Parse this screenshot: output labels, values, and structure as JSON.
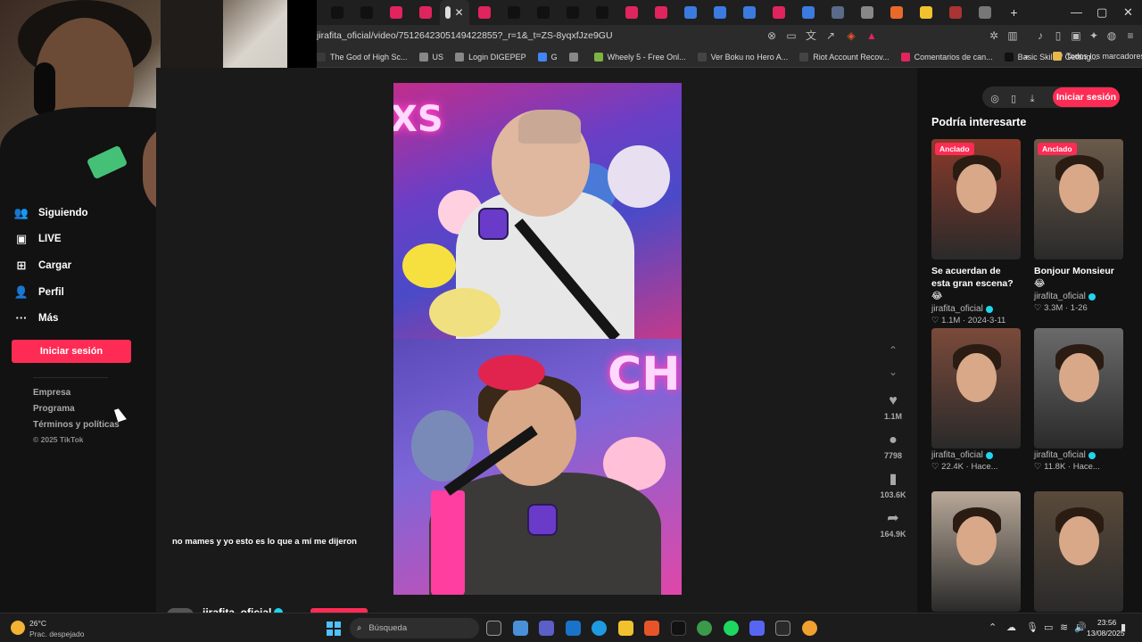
{
  "browser": {
    "url": "jirafita_oficial/video/7512642305149422855?_r=1&_t=ZS-8yqxfJze9GU",
    "tab_favicon_colors": [
      "#111",
      "#111",
      "#e0245e",
      "#e0245e",
      "#ddd",
      "#e0245e",
      "#111",
      "#111",
      "#111",
      "#111",
      "#e0245e",
      "#e0245e",
      "#3b7be0",
      "#3b7be0",
      "#3b7be0",
      "#e0245e",
      "#3b7be0",
      "#5a6a8a",
      "#888",
      "#e86a2a",
      "#f2c12e",
      "#a33",
      "#777"
    ],
    "bookmarks": [
      {
        "label": "The God of High Sc...",
        "color": "#3a3a3a"
      },
      {
        "label": "US",
        "color": "#888"
      },
      {
        "label": "Login DIGEPEP",
        "color": "#888"
      },
      {
        "label": "G",
        "color": "#4285f4"
      },
      {
        "label": "",
        "color": "#888"
      },
      {
        "label": "Wheely 5 - Free Onl...",
        "color": "#7cb342"
      },
      {
        "label": "Ver Boku no Hero A...",
        "color": "#444"
      },
      {
        "label": "Riot Account Recov...",
        "color": "#444"
      },
      {
        "label": "Comentarios de can...",
        "color": "#e0245e"
      },
      {
        "label": "Basic Skills / Getting...",
        "color": "#111"
      }
    ],
    "bookmarks_more": "»",
    "all_bookmarks": "Todos los marcadores"
  },
  "sidebar": {
    "items": [
      {
        "icon": "following-icon",
        "glyph": "👥",
        "label": "Siguiendo"
      },
      {
        "icon": "live-icon",
        "glyph": "▣",
        "label": "LIVE"
      },
      {
        "icon": "upload-icon",
        "glyph": "⊞",
        "label": "Cargar"
      },
      {
        "icon": "profile-icon",
        "glyph": "👤",
        "label": "Perfil"
      },
      {
        "icon": "more-icon",
        "glyph": "···",
        "label": "Más"
      }
    ],
    "login_label": "Iniciar sesión",
    "footer": [
      "Empresa",
      "Programa",
      "Términos y políticas"
    ],
    "copyright": "© 2025 TikTok"
  },
  "video": {
    "caption": "no mames y yo esto es lo que a mí me dijeron",
    "neon_top": "XS",
    "neon_bottom": "CHI",
    "author": "jirafita_oficial",
    "likes": "1.1M",
    "comments": "7798",
    "saves": "103.6K",
    "shares": "164.9K"
  },
  "right": {
    "login_label": "Iniciar sesión",
    "section_title": "Podría interesarte",
    "cards": [
      {
        "pinned": true,
        "pin_label": "Anclado",
        "title": "Se acuerdan de esta gran escena? 😂",
        "author": "jirafita_oficial",
        "likes": "1.1M",
        "date": "2024-3-11",
        "bg": "#8a3a2a"
      },
      {
        "pinned": true,
        "pin_label": "Anclado",
        "title": "Bonjour Monsieur 😂",
        "author": "jirafita_oficial",
        "likes": "3.3M",
        "date": "1-26",
        "bg": "#6a5a4a"
      },
      {
        "pinned": false,
        "title": "",
        "author": "jirafita_oficial",
        "likes": "22.4K",
        "date": "Hace...",
        "bg": "#7a4a3a"
      },
      {
        "pinned": false,
        "title": "",
        "author": "jirafita_oficial",
        "likes": "11.8K",
        "date": "Hace...",
        "bg": "#6a6a6a"
      },
      {
        "pinned": false,
        "title": "",
        "author": "",
        "likes": "",
        "date": "",
        "bg": "#b8a898"
      },
      {
        "pinned": false,
        "title": "",
        "author": "",
        "likes": "",
        "date": "",
        "bg": "#5a4a3a"
      }
    ]
  },
  "taskbar": {
    "temperature": "26°C",
    "weather": "Prac. despejado",
    "search_placeholder": "Búsqueda",
    "time": "23:56",
    "date": "13/08/2025"
  }
}
